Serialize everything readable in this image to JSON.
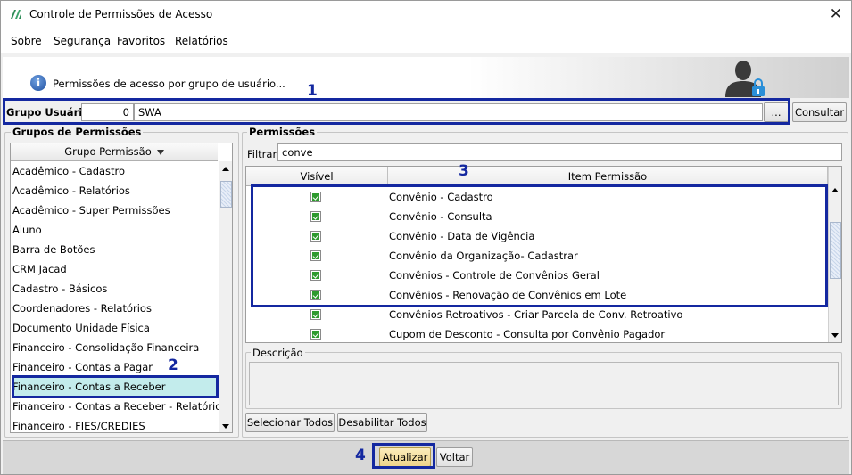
{
  "window": {
    "title": "Controle de Permissões de Acesso",
    "close_glyph": "✕"
  },
  "menu": [
    {
      "label": "Sobre"
    },
    {
      "label": "Segurança"
    },
    {
      "label": "Favoritos"
    },
    {
      "label": "Relatórios"
    }
  ],
  "banner": {
    "text": "Permissões de acesso por grupo de usuário...",
    "info_glyph": "i"
  },
  "grupo_usuario": {
    "label": "Grupo Usuário:",
    "code": "0",
    "name": "SWA",
    "browse_label": "...",
    "consultar_label": "Consultar"
  },
  "grupos": {
    "title": "Grupos de Permissões",
    "column_header": "Grupo Permissão",
    "items": [
      "Acadêmico - Cadastro",
      "Acadêmico - Relatórios",
      "Acadêmico - Super Permissões",
      "Aluno",
      "Barra de Botões",
      "CRM Jacad",
      "Cadastro - Básicos",
      "Coordenadores - Relatórios",
      "Documento Unidade Física",
      "Financeiro - Consolidação Financeira",
      "Financeiro - Contas a Pagar",
      "Financeiro - Contas a Receber",
      "Financeiro - Contas a Receber - Relatórios",
      "Financeiro - FIES/CREDIES"
    ],
    "selected": "Financeiro - Contas a Receber"
  },
  "permissoes": {
    "title": "Permissões",
    "filter_label": "Filtrar:",
    "filter_value": "conve",
    "columns": [
      "Visível",
      "Item Permissão"
    ],
    "rows": [
      {
        "item": "Convênio - Cadastro",
        "visible": true
      },
      {
        "item": "Convênio - Consulta",
        "visible": true
      },
      {
        "item": "Convênio - Data de Vigência",
        "visible": true
      },
      {
        "item": "Convênio da Organização- Cadastrar",
        "visible": true
      },
      {
        "item": "Convênios - Controle de Convênios Geral",
        "visible": true
      },
      {
        "item": "Convênios - Renovação de Convênios em Lote",
        "visible": true
      },
      {
        "item": "Convênios Retroativos - Criar Parcela de Conv. Retroativo",
        "visible": true
      },
      {
        "item": "Cupom de Desconto -  Consulta por Convênio Pagador",
        "visible": true
      }
    ]
  },
  "descricao": {
    "title": "Descrição",
    "text": ""
  },
  "buttons": {
    "select_all": "Selecionar Todos",
    "disable_all": "Desabilitar Todos",
    "atualizar": "Atualizar",
    "voltar": "Voltar"
  },
  "callouts": [
    "1",
    "2",
    "3",
    "4"
  ],
  "colors": {
    "callout_blue": "#1428a0",
    "selected_row": "#c3ecec",
    "check_green": "#2e9a2e",
    "atualizar_bg": "#f2dfa0"
  }
}
